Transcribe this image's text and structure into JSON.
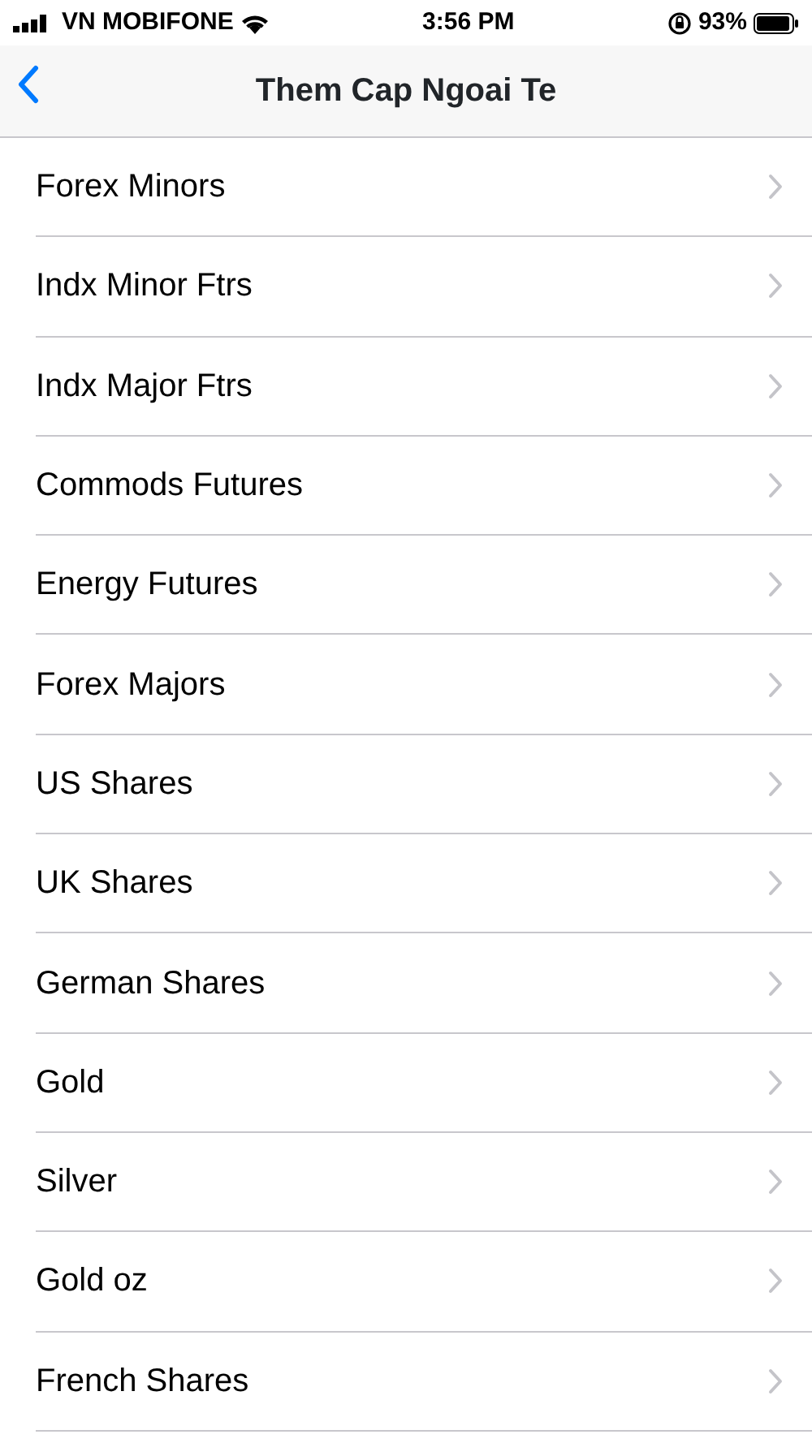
{
  "status_bar": {
    "carrier": "VN MOBIFONE",
    "time": "3:56 PM",
    "battery": "93%"
  },
  "nav": {
    "title": "Them Cap Ngoai Te"
  },
  "items": [
    {
      "label": "Forex Minors"
    },
    {
      "label": "Indx Minor Ftrs"
    },
    {
      "label": "Indx Major Ftrs"
    },
    {
      "label": "Commods Futures"
    },
    {
      "label": "Energy Futures"
    },
    {
      "label": "Forex Majors"
    },
    {
      "label": "US Shares"
    },
    {
      "label": "UK Shares"
    },
    {
      "label": "German Shares"
    },
    {
      "label": "Gold"
    },
    {
      "label": "Silver"
    },
    {
      "label": "Gold oz"
    },
    {
      "label": "French Shares"
    }
  ]
}
